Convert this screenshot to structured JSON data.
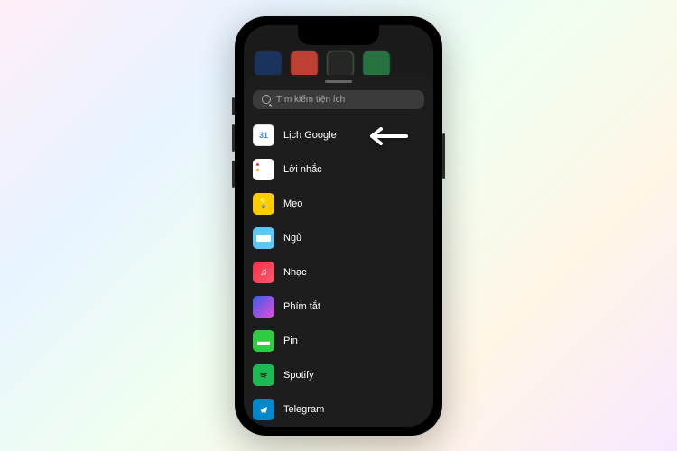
{
  "search": {
    "placeholder": "Tìm kiếm tiện ích"
  },
  "widgets": [
    {
      "label": "Lịch Google",
      "icon": "calendar",
      "badge": "31"
    },
    {
      "label": "Lời nhắc",
      "icon": "reminders"
    },
    {
      "label": "Mẹo",
      "icon": "tips"
    },
    {
      "label": "Ngủ",
      "icon": "sleep"
    },
    {
      "label": "Nhạc",
      "icon": "music"
    },
    {
      "label": "Phím tắt",
      "icon": "shortcuts"
    },
    {
      "label": "Pin",
      "icon": "pin"
    },
    {
      "label": "Spotify",
      "icon": "spotify"
    },
    {
      "label": "Telegram",
      "icon": "telegram"
    }
  ],
  "highlighted_index": 0
}
